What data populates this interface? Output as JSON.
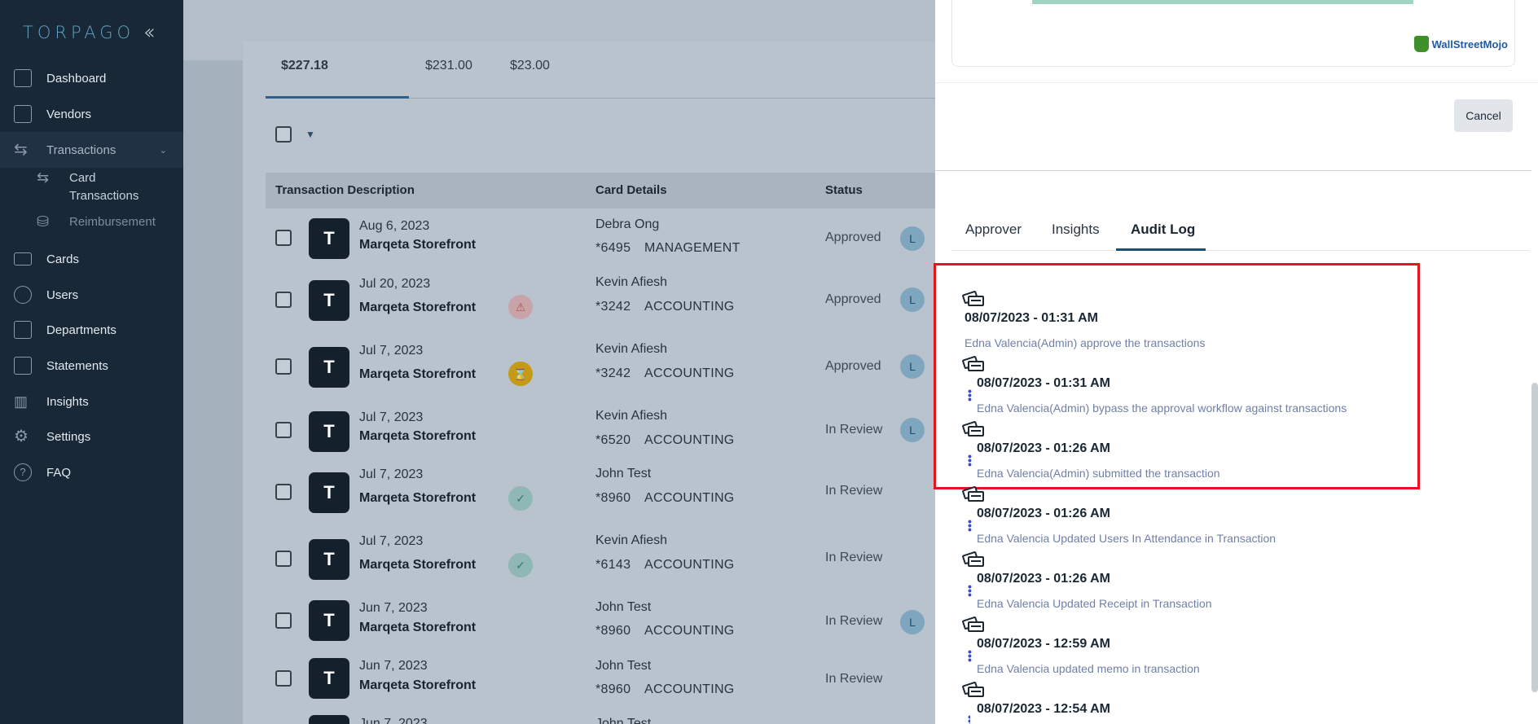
{
  "app": {
    "logo_text": "TORPAGO"
  },
  "sidebar": {
    "collapse_icon": "double-chevron-left-icon",
    "items": [
      {
        "label": "Dashboard",
        "icon": "dashboard-icon"
      },
      {
        "label": "Vendors",
        "icon": "store-icon"
      },
      {
        "label": "Transactions",
        "icon": "transfer-icon"
      },
      {
        "label": "Cards",
        "icon": "card-icon"
      },
      {
        "label": "Users",
        "icon": "user-icon"
      },
      {
        "label": "Departments",
        "icon": "building-icon"
      },
      {
        "label": "Statements",
        "icon": "document-icon"
      },
      {
        "label": "Insights",
        "icon": "bar-chart-icon"
      },
      {
        "label": "Settings",
        "icon": "gear-icon"
      },
      {
        "label": "FAQ",
        "icon": "help-icon"
      }
    ],
    "sub_items": [
      {
        "label_line1": "Card",
        "label_line2": "Transactions"
      },
      {
        "label_line1": "Reimbursement",
        "label_line2": ""
      }
    ]
  },
  "summary_tabs": [
    "$227.18",
    "$231.00",
    "$23.00"
  ],
  "table": {
    "headers": [
      "Transaction Description",
      "Card Details",
      "Status"
    ],
    "rows": [
      {
        "date": "Aug 6, 2023",
        "vendor": "Marqeta Storefront",
        "avatar": "T",
        "cardholder": "Debra Ong",
        "card": "*6495",
        "dept": "MANAGEMENT",
        "status": "Approved",
        "flag": ""
      },
      {
        "date": "Jul 20, 2023",
        "vendor": "Marqeta Storefront",
        "avatar": "T",
        "cardholder": "Kevin Afiesh",
        "card": "*3242",
        "dept": "ACCOUNTING",
        "status": "Approved",
        "flag": "warning"
      },
      {
        "date": "Jul 7, 2023",
        "vendor": "Marqeta Storefront",
        "avatar": "T",
        "cardholder": "Kevin Afiesh",
        "card": "*3242",
        "dept": "ACCOUNTING",
        "status": "Approved",
        "flag": "pending"
      },
      {
        "date": "Jul 7, 2023",
        "vendor": "Marqeta Storefront",
        "avatar": "T",
        "cardholder": "Kevin Afiesh",
        "card": "*6520",
        "dept": "ACCOUNTING",
        "status": "In Review",
        "flag": ""
      },
      {
        "date": "Jul 7, 2023",
        "vendor": "Marqeta Storefront",
        "avatar": "T",
        "cardholder": "John Test",
        "card": "*8960",
        "dept": "ACCOUNTING",
        "status": "In Review",
        "flag": "check"
      },
      {
        "date": "Jul 7, 2023",
        "vendor": "Marqeta Storefront",
        "avatar": "T",
        "cardholder": "Kevin Afiesh",
        "card": "*6143",
        "dept": "ACCOUNTING",
        "status": "In Review",
        "flag": "check"
      },
      {
        "date": "Jun 7, 2023",
        "vendor": "Marqeta Storefront",
        "avatar": "T",
        "cardholder": "John Test",
        "card": "*8960",
        "dept": "ACCOUNTING",
        "status": "In Review",
        "flag": ""
      },
      {
        "date": "Jun 7, 2023",
        "vendor": "Marqeta Storefront",
        "avatar": "T",
        "cardholder": "John Test",
        "card": "*8960",
        "dept": "ACCOUNTING",
        "status": "In Review",
        "flag": ""
      },
      {
        "date": "Jun 7, 2023",
        "vendor": "",
        "avatar": "",
        "cardholder": "John Test",
        "card": "",
        "dept": "",
        "status": "",
        "flag": ""
      }
    ]
  },
  "panel": {
    "watermark": "WallStreetMojo",
    "cancel_label": "Cancel",
    "tabs": [
      "Approver",
      "Insights",
      "Audit Log"
    ],
    "audit_log": [
      {
        "datetime": "08/07/2023 - 01:31 AM",
        "text": "Edna Valencia(Admin) approve the transactions"
      },
      {
        "datetime": "08/07/2023 - 01:31 AM",
        "text": "Edna Valencia(Admin) bypass the approval workflow against transactions"
      },
      {
        "datetime": "08/07/2023 - 01:26 AM",
        "text": "Edna Valencia(Admin) submitted the transaction"
      },
      {
        "datetime": "08/07/2023 - 01:26 AM",
        "text": "Edna Valencia Updated Users In Attendance in Transaction"
      },
      {
        "datetime": "08/07/2023 - 01:26 AM",
        "text": "Edna Valencia Updated Receipt in Transaction"
      },
      {
        "datetime": "08/07/2023 - 12:59 AM",
        "text": "Edna Valencia updated memo in transaction"
      },
      {
        "datetime": "08/07/2023 - 12:54 AM",
        "text": ""
      }
    ]
  },
  "colors": {
    "highlight": "#e8141c",
    "sidebar_bg": "#182837",
    "accent": "#1f4f6e"
  }
}
